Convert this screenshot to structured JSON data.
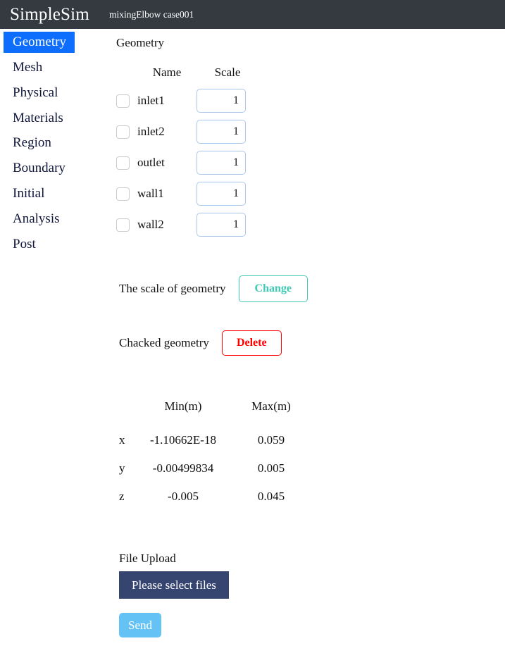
{
  "header": {
    "brand": "SimpleSim",
    "case_name": "mixingElbow case001",
    "background_color": "#343a40"
  },
  "sidebar": {
    "active_color": "#0d6efd",
    "items": [
      {
        "label": "Geometry",
        "active": true
      },
      {
        "label": "Mesh",
        "active": false
      },
      {
        "label": "Physical",
        "active": false
      },
      {
        "label": "Materials",
        "active": false
      },
      {
        "label": "Region",
        "active": false
      },
      {
        "label": "Boundary",
        "active": false
      },
      {
        "label": "Initial",
        "active": false
      },
      {
        "label": "Analysis",
        "active": false
      },
      {
        "label": "Post",
        "active": false
      }
    ]
  },
  "main": {
    "section_title": "Geometry",
    "geometry_table": {
      "columns": [
        "Name",
        "Scale"
      ],
      "rows": [
        {
          "name": "inlet1",
          "scale": "1",
          "checked": false
        },
        {
          "name": "inlet2",
          "scale": "1",
          "checked": false
        },
        {
          "name": "outlet",
          "scale": "1",
          "checked": false
        },
        {
          "name": "wall1",
          "scale": "1",
          "checked": false
        },
        {
          "name": "wall2",
          "scale": "1",
          "checked": false
        }
      ]
    },
    "scale_action": {
      "label": "The scale of geometry",
      "button_label": "Change",
      "button_color": "#3ec9b5"
    },
    "delete_action": {
      "label": "Chacked geometry",
      "button_label": "Delete",
      "button_color": "#ff0000"
    },
    "bounds_table": {
      "columns": [
        "Min(m)",
        "Max(m)"
      ],
      "rows": [
        {
          "axis": "x",
          "min": "-1.10662E-18",
          "max": "0.059"
        },
        {
          "axis": "y",
          "min": "-0.00499834",
          "max": "0.005"
        },
        {
          "axis": "z",
          "min": "-0.005",
          "max": "0.045"
        }
      ]
    },
    "upload": {
      "label": "File Upload",
      "select_button_label": "Please select files",
      "select_button_color": "#36456f",
      "send_button_label": "Send",
      "send_button_color": "#64c2f5"
    }
  }
}
